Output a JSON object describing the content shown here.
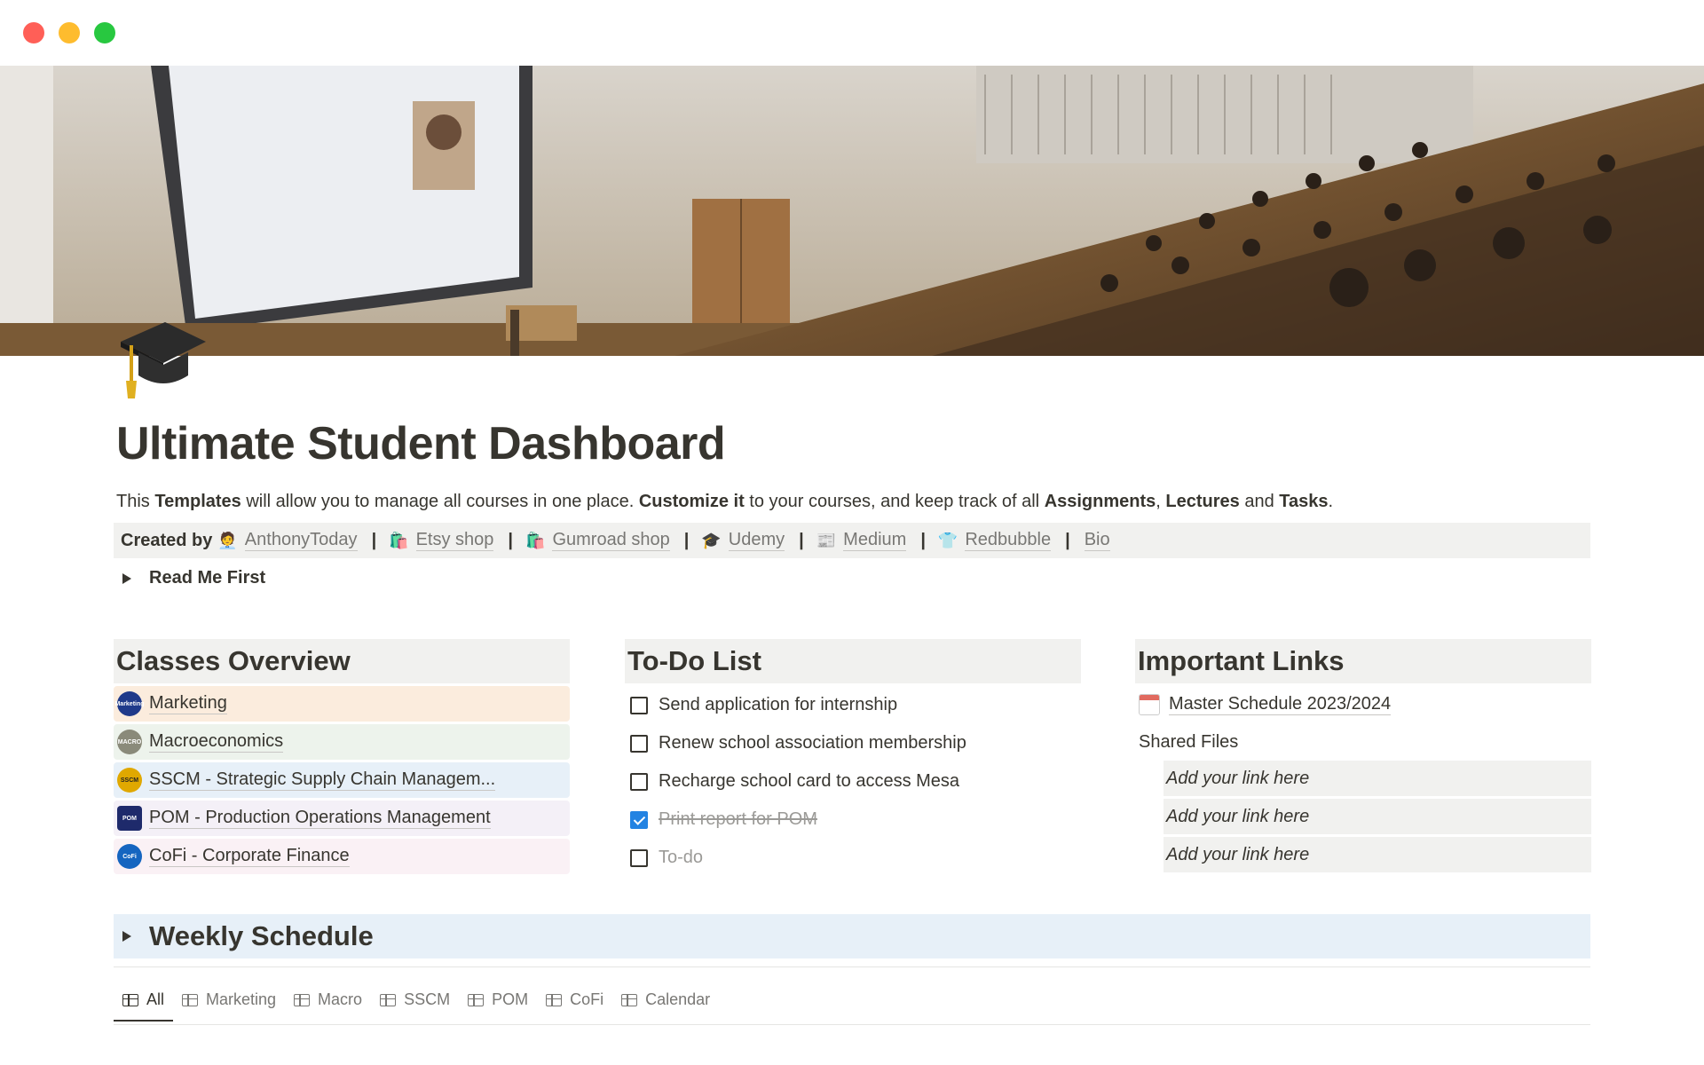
{
  "page": {
    "title": "Ultimate Student Dashboard",
    "description": {
      "p1": "This ",
      "b1": "Templates",
      "p2": " will allow you to manage all courses in one place. ",
      "b2": "Customize it",
      "p3": " to your courses, and keep track of all ",
      "b3": "Assignments",
      "p4": ", ",
      "b4": "Lectures",
      "p5": " and ",
      "b5": "Tasks",
      "p6": "."
    },
    "icon": "graduation-cap-icon"
  },
  "created_by": {
    "label": "Created by",
    "sep": "|",
    "links": [
      {
        "emoji": "🧑‍💼",
        "label": "AnthonyToday"
      },
      {
        "emoji": "🛍️",
        "label": "Etsy shop"
      },
      {
        "emoji": "🛍️",
        "label": "Gumroad shop"
      },
      {
        "emoji": "🎓",
        "label": "Udemy"
      },
      {
        "emoji": "📰",
        "label": "Medium"
      },
      {
        "emoji": "👕",
        "label": "Redbubble"
      },
      {
        "emoji": "",
        "label": "Bio"
      }
    ]
  },
  "read_me": {
    "label": "Read Me First"
  },
  "classes": {
    "title": "Classes Overview",
    "items": [
      {
        "label": "Marketing",
        "badge": "Marketing",
        "color": "#fbecdd",
        "badge_color": "#1f3a8a"
      },
      {
        "label": "Macroeconomics",
        "badge": "MACRO",
        "color": "#edf3ec",
        "badge_color": "#8a8a7a"
      },
      {
        "label": "SSCM - Strategic Supply Chain Managem...",
        "badge": "SSCM",
        "color": "#e7f0f8",
        "badge_color": "#e0a800"
      },
      {
        "label": "POM - Production Operations Management",
        "badge": "POM",
        "color": "#f4f0f7",
        "badge_color": "#1e2a6b"
      },
      {
        "label": "CoFi - Corporate Finance",
        "badge": "CoFi",
        "color": "#faf1f5",
        "badge_color": "#1565c0"
      }
    ]
  },
  "todo": {
    "title": "To-Do List",
    "items": [
      {
        "label": "Send application for internship",
        "checked": false
      },
      {
        "label": "Renew school association membership",
        "checked": false
      },
      {
        "label": "Recharge school card to access Mesa",
        "checked": false
      },
      {
        "label": "Print report for POM",
        "checked": true
      },
      {
        "label": "To-do",
        "checked": false,
        "placeholder": true
      }
    ]
  },
  "links": {
    "title": "Important Links",
    "master": "Master Schedule 2023/2024",
    "shared_label": "Shared Files",
    "shared": [
      "Add your link here",
      "Add your link here",
      "Add your link here"
    ]
  },
  "weekly": {
    "label": "Weekly Schedule"
  },
  "tabs": [
    {
      "label": "All",
      "active": true,
      "icon": "table-icon"
    },
    {
      "label": "Marketing",
      "icon": "table-icon"
    },
    {
      "label": "Macro",
      "icon": "table-icon"
    },
    {
      "label": "SSCM",
      "icon": "table-icon"
    },
    {
      "label": "POM",
      "icon": "table-icon"
    },
    {
      "label": "CoFi",
      "icon": "table-icon"
    },
    {
      "label": "Calendar",
      "icon": "calendar-icon"
    }
  ],
  "colors": {
    "text": "#37352f",
    "muted": "#787774",
    "gray_bg": "#f1f1ef",
    "blue_bg": "#e7f0f8",
    "checkbox_blue": "#2383e2"
  }
}
